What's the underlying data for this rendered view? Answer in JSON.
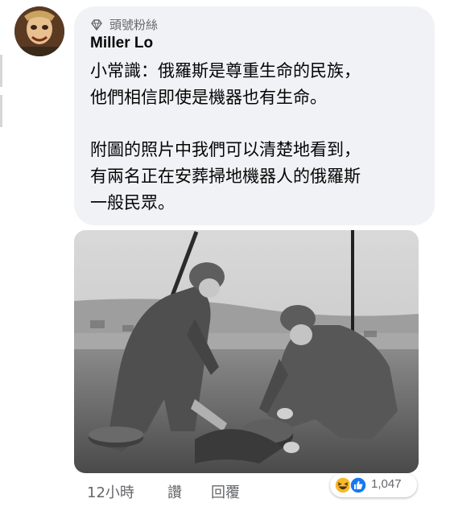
{
  "comment": {
    "badge_label": "頭號粉絲",
    "badge_icon": "diamond-icon",
    "author": "Miller Lo",
    "lines": [
      "小常識：俄羅斯是尊重生命的民族，",
      "他們相信即使是機器也有生命。",
      "附圖的照片中我們可以清楚地看到，",
      "有兩名正在安葬掃地機器人的俄羅斯",
      "一般民眾。"
    ]
  },
  "footer": {
    "time": "12小時",
    "like_label": "讚",
    "reply_label": "回覆"
  },
  "reactions": {
    "icons": [
      "haha-icon",
      "like-icon"
    ],
    "count": "1,047"
  },
  "colors": {
    "bubble": "#f0f2f5",
    "secondary_text": "#65676b",
    "like_blue": "#1877f2",
    "haha_yellow": "#f7b928"
  }
}
